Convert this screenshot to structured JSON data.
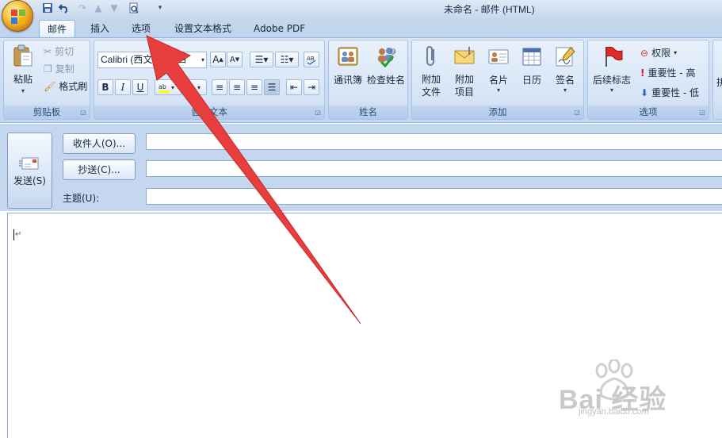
{
  "window": {
    "title": "未命名 - 邮件 (HTML)"
  },
  "tabs": [
    {
      "label": "邮件",
      "active": true
    },
    {
      "label": "插入",
      "active": false
    },
    {
      "label": "选项",
      "active": false
    },
    {
      "label": "设置文本格式",
      "active": false
    },
    {
      "label": "Adobe PDF",
      "active": false
    }
  ],
  "clipboard": {
    "label": "剪贴板",
    "paste": "粘贴",
    "cut": "剪切",
    "copy": "复制",
    "format_painter": "格式刷"
  },
  "basic_text": {
    "label": "普通文本",
    "font": "Calibri (西文",
    "size": "小四",
    "bold": "B",
    "italic": "I",
    "underline": "U"
  },
  "names": {
    "label": "姓名",
    "address_book": "通讯簿",
    "check_names": "检查姓名"
  },
  "include": {
    "label": "添加",
    "attach_file": "附加\n文件",
    "attach_item": "附加\n项目",
    "business_card": "名片",
    "calendar": "日历",
    "signature": "签名"
  },
  "options": {
    "label": "选项",
    "follow_up": "后续标志",
    "permission": "权限",
    "high_importance": "重要性 - 高",
    "low_importance": "重要性 - 低",
    "partial": "拼"
  },
  "compose": {
    "send": "发送(S)",
    "to": "收件人(O)...",
    "cc": "抄送(C)...",
    "subject": "主题(U):",
    "to_value": "",
    "cc_value": "",
    "subject_value": ""
  },
  "body": {
    "paragraph_mark": "↵"
  },
  "watermark": {
    "brand": "Bai 经验",
    "url": "jingyan.baidu.com"
  },
  "colors": {
    "ribbon_bg": "#cadcf2",
    "tab_active_border": "#8db2e3",
    "arrow": "#e83e3e"
  }
}
